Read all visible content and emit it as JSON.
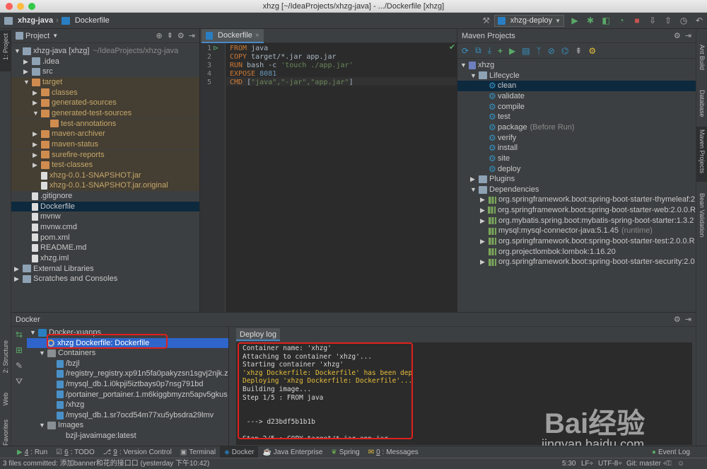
{
  "window": {
    "title": "xhzg [~/IdeaProjects/xhzg-java] - .../Dockerfile [xhzg]"
  },
  "navbar": {
    "crumbs": [
      "xhzg-java",
      "Dockerfile"
    ],
    "run_config": "xhzg-deploy"
  },
  "left_stripe": {
    "project": "1: Project",
    "structure": "2: Structure",
    "web": "Web",
    "favorites": "2: Favorites"
  },
  "right_stripe": {
    "ant": "Ant Build",
    "database": "Database",
    "maven": "Maven Projects",
    "bean": "Bean Validation"
  },
  "project_panel": {
    "title": "Project",
    "tree": [
      {
        "label": "xhzg-java [xhzg]",
        "extra": "~/IdeaProjects/xhzg-java",
        "indent": 0,
        "fold": "▼",
        "icon": "folder"
      },
      {
        "label": ".idea",
        "indent": 1,
        "fold": "▶",
        "icon": "folder"
      },
      {
        "label": "src",
        "indent": 1,
        "fold": "▶",
        "icon": "folder"
      },
      {
        "label": "target",
        "indent": 1,
        "fold": "▼",
        "icon": "folder-o",
        "excluded": true
      },
      {
        "label": "classes",
        "indent": 2,
        "fold": "▶",
        "icon": "folder-o",
        "excluded": true
      },
      {
        "label": "generated-sources",
        "indent": 2,
        "fold": "▶",
        "icon": "folder-o",
        "excluded": true
      },
      {
        "label": "generated-test-sources",
        "indent": 2,
        "fold": "▼",
        "icon": "folder-o",
        "excluded": true
      },
      {
        "label": "test-annotations",
        "indent": 3,
        "fold": "",
        "icon": "folder-o",
        "excluded": true
      },
      {
        "label": "maven-archiver",
        "indent": 2,
        "fold": "▶",
        "icon": "folder-o",
        "excluded": true
      },
      {
        "label": "maven-status",
        "indent": 2,
        "fold": "▶",
        "icon": "folder-o",
        "excluded": true
      },
      {
        "label": "surefire-reports",
        "indent": 2,
        "fold": "▶",
        "icon": "folder-o",
        "excluded": true
      },
      {
        "label": "test-classes",
        "indent": 2,
        "fold": "▶",
        "icon": "folder-o",
        "excluded": true
      },
      {
        "label": "xhzg-0.0.1-SNAPSHOT.jar",
        "indent": 2,
        "fold": "",
        "icon": "file",
        "excluded": true
      },
      {
        "label": "xhzg-0.0.1-SNAPSHOT.jar.original",
        "indent": 2,
        "fold": "",
        "icon": "file",
        "excluded": true
      },
      {
        "label": ".gitignore",
        "indent": 1,
        "fold": "",
        "icon": "file"
      },
      {
        "label": "Dockerfile",
        "indent": 1,
        "fold": "",
        "icon": "file",
        "selected": true
      },
      {
        "label": "mvnw",
        "indent": 1,
        "fold": "",
        "icon": "file"
      },
      {
        "label": "mvnw.cmd",
        "indent": 1,
        "fold": "",
        "icon": "file"
      },
      {
        "label": "pom.xml",
        "indent": 1,
        "fold": "",
        "icon": "file"
      },
      {
        "label": "README.md",
        "indent": 1,
        "fold": "",
        "icon": "file"
      },
      {
        "label": "xhzg.iml",
        "indent": 1,
        "fold": "",
        "icon": "file"
      },
      {
        "label": "External Libraries",
        "indent": 0,
        "fold": "▶",
        "icon": "folder"
      },
      {
        "label": "Scratches and Consoles",
        "indent": 0,
        "fold": "▶",
        "icon": "folder"
      }
    ]
  },
  "editor": {
    "tab": "Dockerfile",
    "lines": [
      {
        "n": "1",
        "kw": "FROM",
        "rest": " java"
      },
      {
        "n": "2",
        "kw": "COPY",
        "rest": " target/*.jar app.jar"
      },
      {
        "n": "3",
        "kw": "RUN",
        "rest": " bash -c ",
        "str": "'touch ./app.jar'"
      },
      {
        "n": "4",
        "kw": "EXPOSE",
        "rest": " ",
        "num": "8081"
      },
      {
        "n": "5",
        "kw": "CMD",
        "rest": " [",
        "str": "\"java\",\"-jar\",\"app.jar\"",
        "tail": "]"
      }
    ]
  },
  "maven": {
    "title": "Maven Projects",
    "tree": [
      {
        "label": "xhzg",
        "indent": 0,
        "fold": "▼",
        "icon": "m"
      },
      {
        "label": "Lifecycle",
        "indent": 1,
        "fold": "▼",
        "icon": "folder"
      },
      {
        "label": "clean",
        "indent": 2,
        "icon": "gear",
        "selected": true
      },
      {
        "label": "validate",
        "indent": 2,
        "icon": "gear"
      },
      {
        "label": "compile",
        "indent": 2,
        "icon": "gear"
      },
      {
        "label": "test",
        "indent": 2,
        "icon": "gear"
      },
      {
        "label": "package",
        "extra": "(Before Run)",
        "indent": 2,
        "icon": "gear"
      },
      {
        "label": "verify",
        "indent": 2,
        "icon": "gear"
      },
      {
        "label": "install",
        "indent": 2,
        "icon": "gear"
      },
      {
        "label": "site",
        "indent": 2,
        "icon": "gear"
      },
      {
        "label": "deploy",
        "indent": 2,
        "icon": "gear"
      },
      {
        "label": "Plugins",
        "indent": 1,
        "fold": "▶",
        "icon": "folder"
      },
      {
        "label": "Dependencies",
        "indent": 1,
        "fold": "▼",
        "icon": "folder"
      },
      {
        "label": "org.springframework.boot:spring-boot-starter-thymeleaf:2",
        "indent": 2,
        "fold": "▶",
        "icon": "dep"
      },
      {
        "label": "org.springframework.boot:spring-boot-starter-web:2.0.0.R",
        "indent": 2,
        "fold": "▶",
        "icon": "dep"
      },
      {
        "label": "org.mybatis.spring.boot:mybatis-spring-boot-starter:1.3.2",
        "indent": 2,
        "fold": "▶",
        "icon": "dep"
      },
      {
        "label": "mysql:mysql-connector-java:5.1.45",
        "extra": "(runtime)",
        "indent": 2,
        "fold": "",
        "icon": "dep"
      },
      {
        "label": "org.springframework.boot:spring-boot-starter-test:2.0.0.R",
        "indent": 2,
        "fold": "▶",
        "icon": "dep"
      },
      {
        "label": "org.projectlombok:lombok:1.16.20",
        "indent": 2,
        "fold": "",
        "icon": "dep"
      },
      {
        "label": "org.springframework.boot:spring-boot-starter-security:2.0",
        "indent": 2,
        "fold": "▶",
        "icon": "dep"
      }
    ]
  },
  "docker": {
    "title": "Docker",
    "tree": [
      {
        "label": "Docker-xuanps",
        "indent": 0,
        "fold": "▼",
        "icon": "docker"
      },
      {
        "label": "xhzg Dockerfile: Dockerfile",
        "indent": 1,
        "fold": "",
        "icon": "spin",
        "selected": true
      },
      {
        "label": "Containers",
        "indent": 1,
        "fold": "▼",
        "icon": "grid"
      },
      {
        "label": "/bzjl",
        "indent": 2,
        "icon": "box"
      },
      {
        "label": "/registry_registry.xp91n5fa0pakyzsn1sgvj2njk.z",
        "indent": 2,
        "icon": "box"
      },
      {
        "label": "/mysql_db.1.i0kpji5iztbays0p7nsg791bd",
        "indent": 2,
        "icon": "box"
      },
      {
        "label": "/portainer_portainer.1.m6kiggbmyzn5apv5gkus",
        "indent": 2,
        "icon": "box"
      },
      {
        "label": "/xhzg",
        "indent": 2,
        "icon": "box"
      },
      {
        "label": "/mysql_db.1.sr7ocd54m77xu5ybsdra29lmv",
        "indent": 2,
        "icon": "box"
      },
      {
        "label": "Images",
        "indent": 1,
        "fold": "▼",
        "icon": "grid"
      },
      {
        "label": "bzjl-javaimage:latest",
        "indent": 2,
        "icon": "none"
      }
    ],
    "deploy_tab": "Deploy log",
    "log": [
      {
        "t": "Container name: 'xhzg'",
        "c": "w"
      },
      {
        "t": "Attaching to container 'xhzg'...",
        "c": "w"
      },
      {
        "t": "Starting container 'xhzg'",
        "c": "w"
      },
      {
        "t": "'xhzg Dockerfile: Dockerfile' has been deployed successfully.",
        "c": "y"
      },
      {
        "t": "Deploying 'xhzg Dockerfile: Dockerfile'...",
        "c": "y"
      },
      {
        "t": "Building image...",
        "c": "w"
      },
      {
        "t": "Step 1/5 : FROM java",
        "c": "w"
      },
      {
        "t": "",
        "c": "w"
      },
      {
        "t": "",
        "c": "w"
      },
      {
        "t": " ---> d23bdf5b1b1b",
        "c": "w"
      },
      {
        "t": "",
        "c": "w"
      },
      {
        "t": "Step 2/5 : COPY target/*.jar app.jar",
        "c": "w"
      }
    ]
  },
  "bottom_tabs": [
    {
      "key": "4",
      "label": ": Run"
    },
    {
      "key": "6",
      "label": ": TODO"
    },
    {
      "key": "9",
      "label": ": Version Control"
    },
    {
      "key": "",
      "label": "Terminal"
    },
    {
      "key": "",
      "label": "Docker",
      "active": true
    },
    {
      "key": "",
      "label": "Java Enterprise"
    },
    {
      "key": "",
      "label": "Spring"
    },
    {
      "key": "0",
      "label": ": Messages"
    }
  ],
  "event_log": "Event Log",
  "status": {
    "message": "3 files committed: 添加banner和花的接口口 (yesterday 下午10:42)",
    "position": "5:30",
    "line_sep": "LF÷",
    "encoding": "UTF-8÷",
    "git": "Git: master ÷"
  },
  "watermark": {
    "text": "Bai经验",
    "url": "jingyan.baidu.com"
  },
  "colors": {
    "selection": "#0d293e",
    "accent": "#3592c4",
    "highlight_box": "#e0201c",
    "warning_text": "#e8bf3a"
  }
}
